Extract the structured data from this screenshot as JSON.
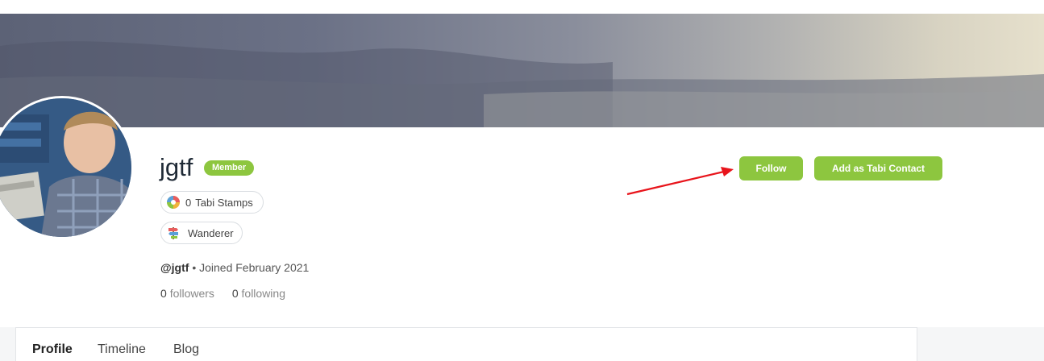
{
  "profile": {
    "username": "jgtf",
    "badge": "Member",
    "stamps_count": "0",
    "stamps_label": "Tabi Stamps",
    "rank": "Wanderer",
    "handle": "@jgtf",
    "separator": "•",
    "joined": "Joined February 2021",
    "followers_count": "0",
    "followers_label": "followers",
    "following_count": "0",
    "following_label": "following"
  },
  "actions": {
    "follow": "Follow",
    "add_contact": "Add as Tabi Contact"
  },
  "tabs": [
    {
      "label": "Profile",
      "active": true
    },
    {
      "label": "Timeline",
      "active": false
    },
    {
      "label": "Blog",
      "active": false
    }
  ],
  "colors": {
    "accent": "#8dc63f",
    "annotation_arrow": "#e8141b"
  },
  "icons": {
    "stamp": "stamp-icon",
    "rank": "signpost-icon"
  }
}
